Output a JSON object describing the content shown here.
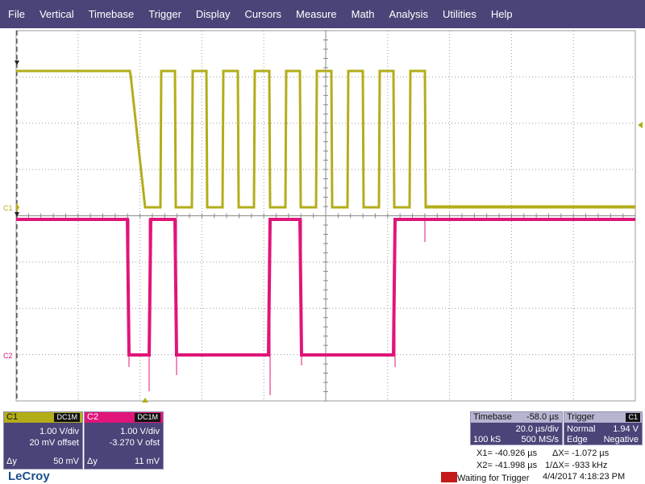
{
  "menu": [
    "File",
    "Vertical",
    "Timebase",
    "Trigger",
    "Display",
    "Cursors",
    "Measure",
    "Math",
    "Analysis",
    "Utilities",
    "Help"
  ],
  "colors": {
    "c1": "#b3ad1a",
    "c2": "#e0157a",
    "menubar": "#4a4478",
    "panel": "#4a4478",
    "grid": "#9a9a9a"
  },
  "markers": {
    "c1_label": "C1",
    "c2_label": "C2",
    "trigger_arrow": "triangle-left",
    "c1_marker_icon": "ground-arrow-icon"
  },
  "channels": [
    {
      "name": "C1",
      "coupling": "DC1M",
      "vdiv": "1.00 V/div",
      "offset": "20 mV offset",
      "dy_label": "Δy",
      "dy_value": "50 mV"
    },
    {
      "name": "C2",
      "coupling": "DC1M",
      "vdiv": "1.00 V/div",
      "offset": "-3.270 V ofst",
      "dy_label": "Δy",
      "dy_value": "11 mV"
    }
  ],
  "timebase": {
    "label": "Timebase",
    "delay": "-58.0 µs",
    "per_div": "20.0 µs/div",
    "samples": "100 kS",
    "rate": "500 MS/s"
  },
  "trigger": {
    "label": "Trigger",
    "source": "C1",
    "mode": "Normal",
    "level": "1.94 V",
    "type": "Edge",
    "slope": "Negative"
  },
  "cursors": {
    "x1": "X1=   -40.926 µs",
    "dx": "ΔX=   -1.072 µs",
    "x2": "X2=   -41.998 µs",
    "inv_dx": "1/ΔX=    -933 kHz"
  },
  "brand": "LeCroy",
  "status": "Waiting for Trigger",
  "datetime": "4/4/2017 4:18:23 PM"
}
